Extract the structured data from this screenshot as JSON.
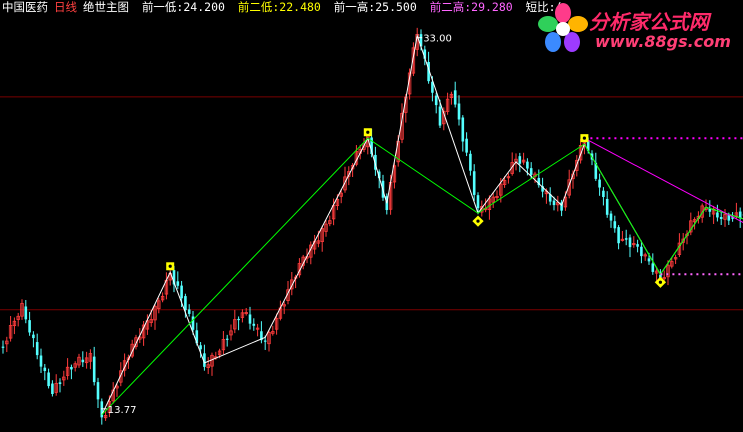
{
  "header": {
    "security_name": "中国医药",
    "period": "日线",
    "indicator_name": "绝世主图",
    "fields": [
      {
        "label": "前一低:",
        "value": "24.200"
      },
      {
        "label": "前二低:",
        "value": "22.480"
      },
      {
        "label": "前一高:",
        "value": "25.500"
      },
      {
        "label": "前二高:",
        "value": "29.280"
      },
      {
        "label": "短比:",
        "value": "("
      }
    ]
  },
  "logo": {
    "text_cn": "分析家公式网",
    "text_url": "www.88gs.com"
  },
  "colors": {
    "background": "#000000",
    "up_candle": "#ff3c3c",
    "down_candle": "#54ffff",
    "zigzag_major": "#00ff00",
    "zigzag_minor": "#ffffff",
    "resistance": "#ff00ff",
    "support": "#ff66ff",
    "grid": "#7a0000",
    "marker": "#ffff00",
    "header_security": "#ffffff",
    "header_period": "#ff4040",
    "header_text": "#ffffff"
  },
  "chart_data": {
    "type": "candlestick",
    "title": "",
    "ylim": [
      13.0,
      34.0
    ],
    "price_labels": [
      {
        "text": "33.00",
        "price": 33.0,
        "index": 109
      },
      {
        "text": "13.77",
        "price": 13.77,
        "index": 26
      }
    ],
    "turning_points": [
      {
        "index": 0,
        "price": 17.2
      },
      {
        "index": 5,
        "price": 19.0
      },
      {
        "index": 13,
        "price": 15.1
      },
      {
        "index": 23,
        "price": 16.8
      },
      {
        "index": 26,
        "price": 13.77
      },
      {
        "index": 44,
        "price": 21.0
      },
      {
        "index": 53,
        "price": 16.4
      },
      {
        "index": 63,
        "price": 18.7
      },
      {
        "index": 69,
        "price": 17.7
      },
      {
        "index": 96,
        "price": 27.8
      },
      {
        "index": 101,
        "price": 24.5
      },
      {
        "index": 109,
        "price": 33.0
      },
      {
        "index": 115,
        "price": 28.9
      },
      {
        "index": 118,
        "price": 30.3
      },
      {
        "index": 125,
        "price": 24.0
      },
      {
        "index": 135,
        "price": 26.6
      },
      {
        "index": 147,
        "price": 24.4
      },
      {
        "index": 153,
        "price": 27.5
      },
      {
        "index": 162,
        "price": 22.8
      },
      {
        "index": 173,
        "price": 20.9
      },
      {
        "index": 185,
        "price": 24.3
      },
      {
        "index": 195,
        "price": 23.7
      }
    ],
    "zigzag_major": [
      {
        "index": 26,
        "price": 13.77
      },
      {
        "index": 96,
        "price": 27.8
      },
      {
        "index": 125,
        "price": 24.0
      },
      {
        "index": 153,
        "price": 27.5
      },
      {
        "index": 173,
        "price": 20.9
      },
      {
        "index": 185,
        "price": 24.3
      },
      {
        "index": 195,
        "price": 23.7
      }
    ],
    "zigzag_minor": [
      {
        "index": 26,
        "price": 13.77
      },
      {
        "index": 44,
        "price": 21.0
      },
      {
        "index": 53,
        "price": 16.4
      },
      {
        "index": 69,
        "price": 17.7
      },
      {
        "index": 96,
        "price": 27.8
      },
      {
        "index": 101,
        "price": 24.5
      },
      {
        "index": 109,
        "price": 33.0
      },
      {
        "index": 125,
        "price": 24.0
      },
      {
        "index": 135,
        "price": 26.6
      },
      {
        "index": 147,
        "price": 24.4
      },
      {
        "index": 153,
        "price": 27.5
      },
      {
        "index": 173,
        "price": 20.9
      },
      {
        "index": 185,
        "price": 24.3
      },
      {
        "index": 195,
        "price": 23.7
      }
    ],
    "markers": [
      {
        "index": 44,
        "price": 21.0,
        "position": "above"
      },
      {
        "index": 96,
        "price": 27.8,
        "position": "above"
      },
      {
        "index": 153,
        "price": 27.5,
        "position": "above"
      },
      {
        "index": 125,
        "price": 24.0,
        "position": "below"
      },
      {
        "index": 173,
        "price": 20.9,
        "position": "below"
      }
    ],
    "resistance_line": {
      "price": 27.8,
      "from_index": 153,
      "to_index": 195
    },
    "support_line": {
      "price": 20.9,
      "from_index": 173,
      "to_index": 195
    },
    "downtrend_line": [
      {
        "index": 153,
        "price": 27.8
      },
      {
        "index": 195,
        "price": 23.5
      }
    ],
    "grid_prices": [
      29.9,
      19.1
    ],
    "grid": true
  }
}
